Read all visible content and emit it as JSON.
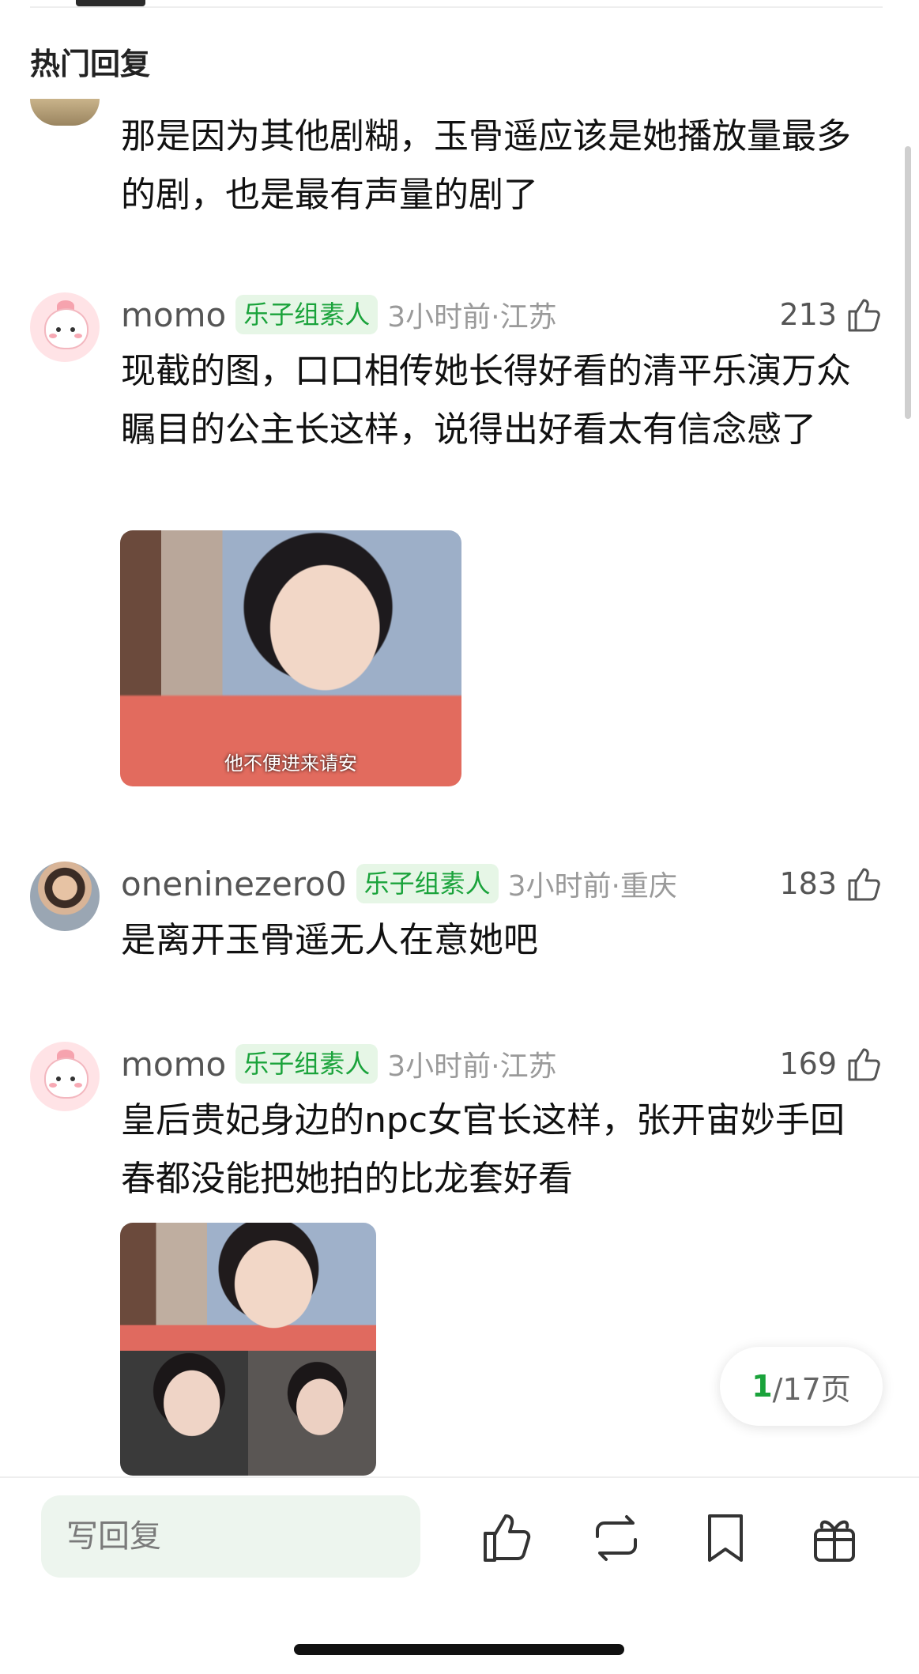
{
  "header": {
    "section_title": "热门回复"
  },
  "comments": [
    {
      "text": "那是因为其他剧糊，玉骨遥应该是她播放量最多的剧，也是最有声量的剧了"
    },
    {
      "username": "momo",
      "badge": "乐子组素人",
      "time": "3小时前·江苏",
      "likes": "213",
      "text": "现截的图，口口相传她长得好看的清平乐演万众瞩目的公主长这样，说得出好看太有信念感了",
      "image_caption": "他不便进来请安"
    },
    {
      "username": "oneninezero0",
      "badge": "乐子组素人",
      "time": "3小时前·重庆",
      "likes": "183",
      "text": "是离开玉骨遥无人在意她吧"
    },
    {
      "username": "momo",
      "badge": "乐子组素人",
      "time": "3小时前·江苏",
      "likes": "169",
      "text": "皇后贵妃身边的npc女官长这样，张开宙妙手回春都没能把她拍的比龙套好看"
    }
  ],
  "pagination": {
    "current": "1",
    "total": "/17页"
  },
  "bottom_bar": {
    "reply_placeholder": "写回复",
    "icons": [
      "thumbs-up-icon",
      "repost-icon",
      "bookmark-icon",
      "gift-icon"
    ]
  },
  "colors": {
    "accent_green": "#1aa33b",
    "badge_bg": "#e6f6e6",
    "input_bg": "#edf5ee"
  }
}
